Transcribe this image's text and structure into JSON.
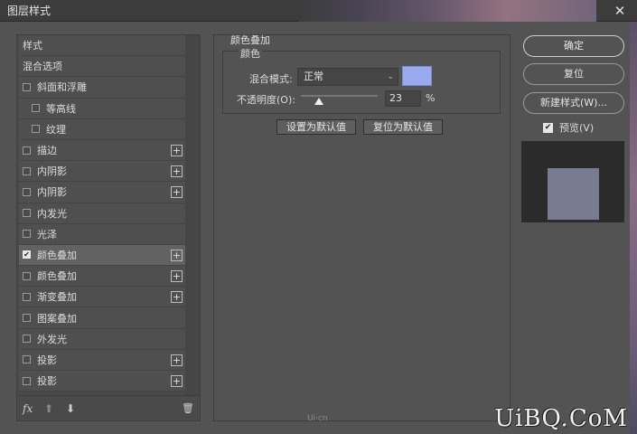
{
  "window": {
    "title": "图层样式",
    "close_glyph": "✕"
  },
  "left_panel": {
    "items": [
      {
        "label": "样式",
        "checkbox": false,
        "checked": false,
        "indent": false,
        "plus": false,
        "selected": false
      },
      {
        "label": "混合选项",
        "checkbox": false,
        "checked": false,
        "indent": false,
        "plus": false,
        "selected": false
      },
      {
        "label": "斜面和浮雕",
        "checkbox": true,
        "checked": false,
        "indent": false,
        "plus": false,
        "selected": false
      },
      {
        "label": "等高线",
        "checkbox": true,
        "checked": false,
        "indent": true,
        "plus": false,
        "selected": false
      },
      {
        "label": "纹理",
        "checkbox": true,
        "checked": false,
        "indent": true,
        "plus": false,
        "selected": false
      },
      {
        "label": "描边",
        "checkbox": true,
        "checked": false,
        "indent": false,
        "plus": true,
        "selected": false
      },
      {
        "label": "内阴影",
        "checkbox": true,
        "checked": false,
        "indent": false,
        "plus": true,
        "selected": false
      },
      {
        "label": "内阴影",
        "checkbox": true,
        "checked": false,
        "indent": false,
        "plus": true,
        "selected": false
      },
      {
        "label": "内发光",
        "checkbox": true,
        "checked": false,
        "indent": false,
        "plus": false,
        "selected": false
      },
      {
        "label": "光泽",
        "checkbox": true,
        "checked": false,
        "indent": false,
        "plus": false,
        "selected": false
      },
      {
        "label": "颜色叠加",
        "checkbox": true,
        "checked": true,
        "indent": false,
        "plus": true,
        "selected": true
      },
      {
        "label": "颜色叠加",
        "checkbox": true,
        "checked": false,
        "indent": false,
        "plus": true,
        "selected": false
      },
      {
        "label": "渐变叠加",
        "checkbox": true,
        "checked": false,
        "indent": false,
        "plus": true,
        "selected": false
      },
      {
        "label": "图案叠加",
        "checkbox": true,
        "checked": false,
        "indent": false,
        "plus": false,
        "selected": false
      },
      {
        "label": "外发光",
        "checkbox": true,
        "checked": false,
        "indent": false,
        "plus": false,
        "selected": false
      },
      {
        "label": "投影",
        "checkbox": true,
        "checked": false,
        "indent": false,
        "plus": true,
        "selected": false
      },
      {
        "label": "投影",
        "checkbox": true,
        "checked": false,
        "indent": false,
        "plus": true,
        "selected": false
      }
    ],
    "plus_glyph": "+",
    "check_glyph": "✔",
    "bottom": {
      "fx": "fx",
      "up": "⬆",
      "down": "⬇",
      "trash": "🗑"
    }
  },
  "settings": {
    "group_title": "颜色叠加",
    "subgroup_title": "颜色",
    "blend_mode_label": "混合模式:",
    "blend_mode_value": "正常",
    "dropdown_arrow": "⌄",
    "color": "#9aa9f0",
    "opacity_label": "不透明度(O):",
    "opacity_value": "23",
    "opacity_fraction": 0.23,
    "percent": "%",
    "make_default": "设置为默认值",
    "reset_default": "复位为默认值"
  },
  "right": {
    "ok": "确定",
    "reset": "复位",
    "new_style": "新建样式(W)...",
    "preview_label": "预览(V)",
    "preview_checked": true,
    "preview_color": "#787c90"
  },
  "watermark": "Ui·cn",
  "brand": "UiBQ.CoM"
}
